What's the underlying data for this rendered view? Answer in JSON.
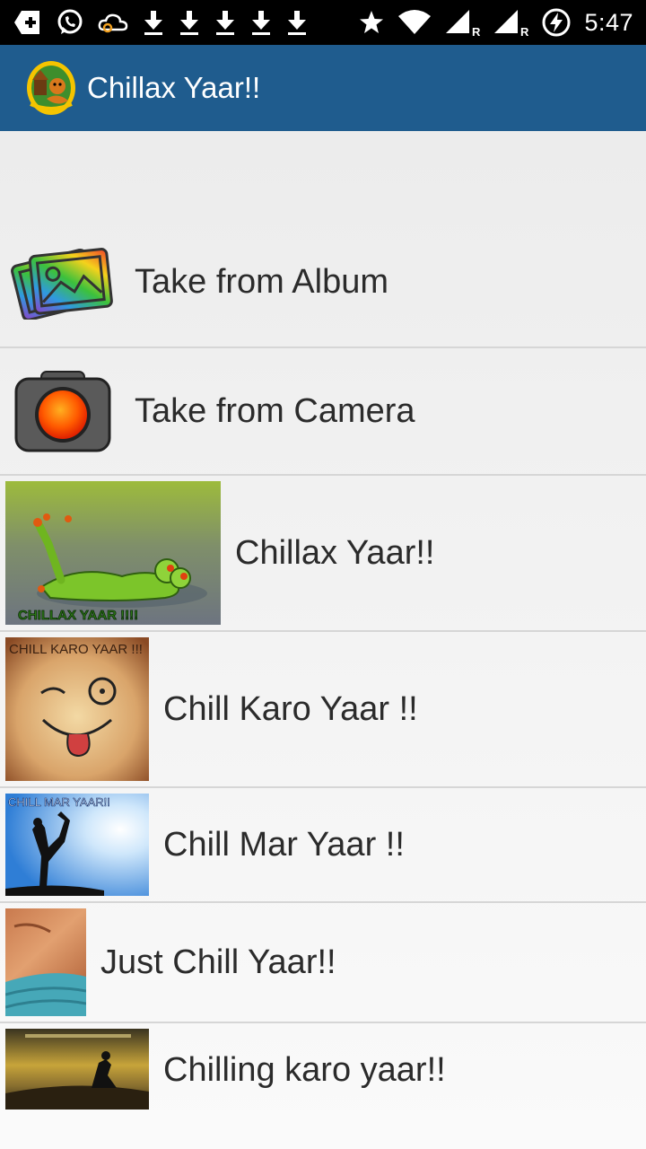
{
  "status_bar": {
    "time": "5:47",
    "left_icons": [
      "add-box-icon",
      "whatsapp-icon",
      "cloud-icon",
      "download-icon",
      "download-icon",
      "download-icon",
      "download-icon",
      "download-icon"
    ],
    "right_icons": [
      "star-icon",
      "wifi-icon",
      "signal-r-icon",
      "signal-r-icon",
      "battery-charging-icon"
    ]
  },
  "app_bar": {
    "title": "Chillax Yaar!!",
    "color": "#1f5c8e"
  },
  "list": {
    "items": [
      {
        "label": "Take from Album",
        "icon": "album-icon"
      },
      {
        "label": "Take from Camera",
        "icon": "camera-icon"
      },
      {
        "label": "Chillax Yaar!!",
        "thumb": "frog-thumbnail",
        "thumb_caption": "CHILLAX YAAR !!!!"
      },
      {
        "label": "Chill Karo Yaar !!",
        "thumb": "wink-face-thumbnail",
        "thumb_caption": "CHILL KARO YAAR !!!"
      },
      {
        "label": "Chill Mar Yaar !!",
        "thumb": "yoga-silhouette-thumbnail",
        "thumb_caption": "CHILL MAR YAAR!!"
      },
      {
        "label": "Just Chill Yaar!!",
        "thumb": "relax-towel-thumbnail"
      },
      {
        "label": "Chilling karo yaar!!",
        "thumb": "sunset-silhouette-thumbnail"
      }
    ]
  }
}
